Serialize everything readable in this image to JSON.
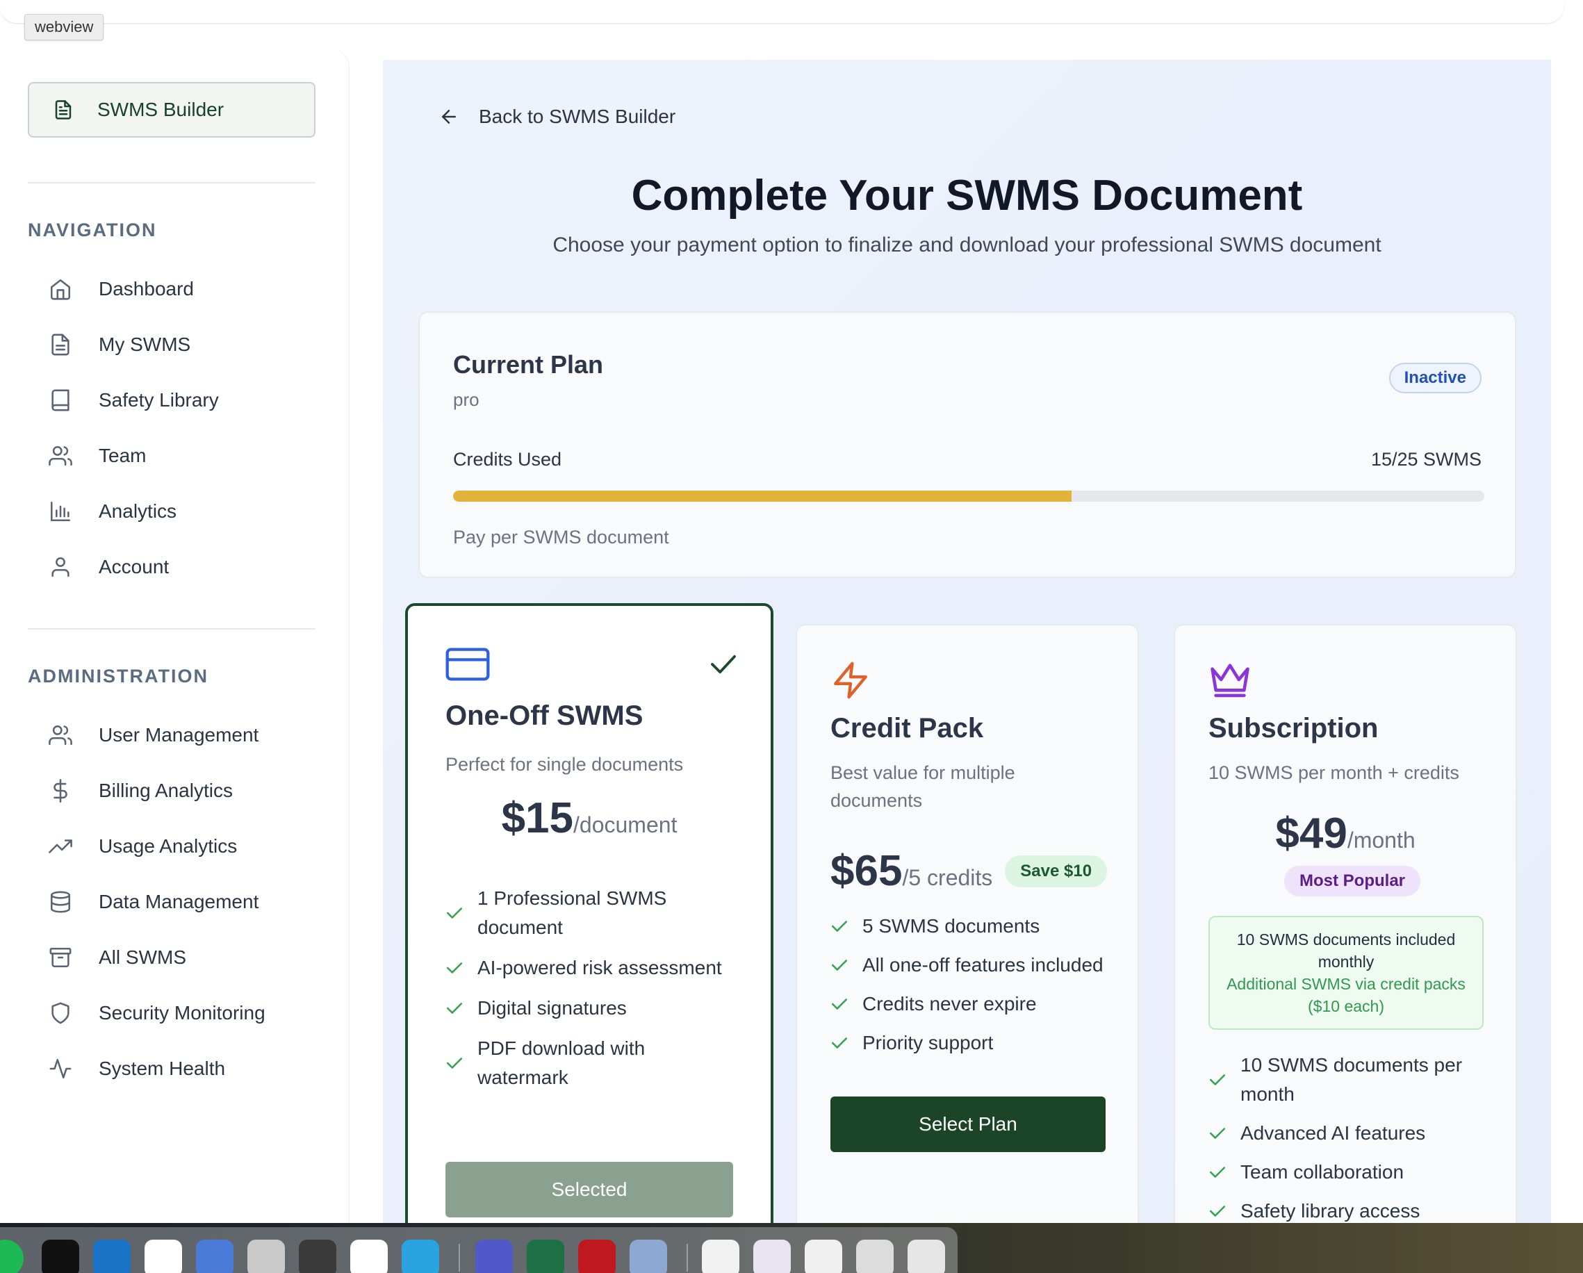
{
  "browser": {
    "tag": "webview"
  },
  "sidebar": {
    "brand_label": "SWMS Builder",
    "navigation_title": "NAVIGATION",
    "navigation": [
      {
        "label": "Dashboard",
        "icon": "home-icon"
      },
      {
        "label": "My SWMS",
        "icon": "document-icon"
      },
      {
        "label": "Safety Library",
        "icon": "book-icon"
      },
      {
        "label": "Team",
        "icon": "users-icon"
      },
      {
        "label": "Analytics",
        "icon": "bar-chart-icon"
      },
      {
        "label": "Account",
        "icon": "user-icon"
      }
    ],
    "administration_title": "ADMINISTRATION",
    "administration": [
      {
        "label": "User Management",
        "icon": "users-icon"
      },
      {
        "label": "Billing Analytics",
        "icon": "dollar-icon"
      },
      {
        "label": "Usage Analytics",
        "icon": "trending-up-icon"
      },
      {
        "label": "Data Management",
        "icon": "database-icon"
      },
      {
        "label": "All SWMS",
        "icon": "archive-icon"
      },
      {
        "label": "Security Monitoring",
        "icon": "shield-icon"
      },
      {
        "label": "System Health",
        "icon": "activity-icon"
      }
    ]
  },
  "main": {
    "back_label": "Back to SWMS Builder",
    "title": "Complete Your SWMS Document",
    "subtitle": "Choose your payment option to finalize and download your professional SWMS document"
  },
  "current_plan": {
    "heading": "Current Plan",
    "tier": "pro",
    "status": "Inactive",
    "credits_label": "Credits Used",
    "credits_value": "15/25 SWMS",
    "credits_used": 15,
    "credits_total": 25,
    "note": "Pay per SWMS document"
  },
  "options": {
    "one_off": {
      "title": "One-Off SWMS",
      "description": "Perfect for single documents",
      "price": "$15",
      "unit": "/document",
      "features": [
        "1 Professional SWMS document",
        "AI-powered risk assessment",
        "Digital signatures",
        "PDF download with watermark"
      ],
      "button": "Selected"
    },
    "credit_pack": {
      "title": "Credit Pack",
      "description": "Best value for multiple documents",
      "price": "$65",
      "unit": "/5 credits",
      "save_badge": "Save $10",
      "features": [
        "5 SWMS documents",
        "All one-off features included",
        "Credits never expire",
        "Priority support"
      ],
      "button": "Select Plan"
    },
    "subscription": {
      "title": "Subscription",
      "description": "10 SWMS per month + credits",
      "price": "$49",
      "unit": "/month",
      "badge": "Most Popular",
      "included_main": "10 SWMS documents included monthly",
      "included_sub": "Additional SWMS via credit packs ($10 each)",
      "features": [
        "10 SWMS documents per month",
        "Advanced AI features",
        "Team collaboration",
        "Safety library access"
      ]
    }
  },
  "colors": {
    "brand_green": "#1c4427",
    "progress": "#e2b33b",
    "credit_icon": "#e0622a",
    "crown_icon": "#8b35d8",
    "card_icon": "#2d5fe0"
  }
}
